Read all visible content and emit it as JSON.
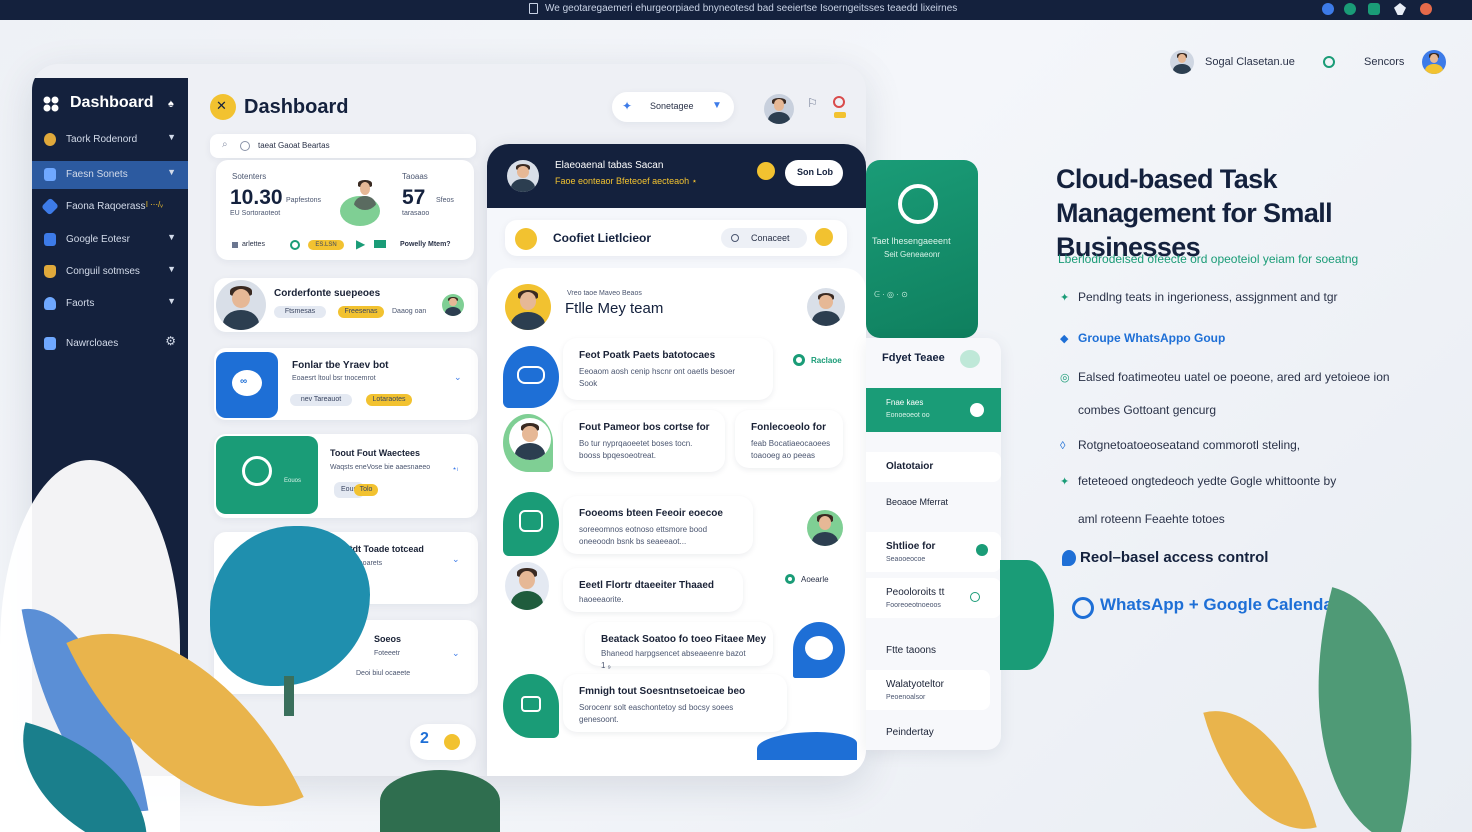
{
  "topbar": {
    "title": "We geotaregaemeri ehurgeorpiaed bnyneotesd bad seeiertse Isoerngeitsses teaedd lixeirnes"
  },
  "header_right": {
    "user_name": "Sogal Clasetan.ue",
    "search_label": "Sencors"
  },
  "sidebar": {
    "title": "Dashboard",
    "items": [
      {
        "label": "Taork Rodenord",
        "color": "#e0a93b"
      },
      {
        "label": "Faesn Sonets",
        "color": "#6fa8ff",
        "active": true
      },
      {
        "label": "Faona Raqoerass",
        "badge": "l ⋯/ᵥ",
        "color": "#3d7be8"
      },
      {
        "label": "Google Eotesr",
        "color": "#3d7be8"
      },
      {
        "label": "Conguil sotmses",
        "color": "#e0a93b"
      },
      {
        "label": "Faorts",
        "color": "#6fa8ff"
      },
      {
        "label": "Nawrcloaes",
        "color": "#6fa8ff"
      }
    ]
  },
  "main": {
    "title": "Dashboard",
    "search_text": "taeat Gaoat Beartas",
    "filter_label": "Sonetagee",
    "stats": {
      "left_label": "Sotenters",
      "left_value": "10.30",
      "left_note": "Papfestons",
      "left_sub": "EU Sortoraoteot",
      "right_label": "Taoaas",
      "right_value": "57",
      "right_note": "Sfeos",
      "right_sub": "tarasaoo",
      "footer_left": "arlettes",
      "footer_right": "Powelly Mtem?",
      "footer_tag": "ES.LSN"
    },
    "cards": [
      {
        "title": "Corderfonte suepeoes",
        "tag1": "Ftsmesas",
        "tag2": "Freesenas",
        "note": "Daaog oan"
      },
      {
        "title": "Fonlar tbe Yraev bot",
        "sub": "Eoaesrt ltoul bsr tnocemrot",
        "tag1": "nev Tareauot",
        "tag2": "Lotaraotes"
      },
      {
        "title": "Toout Fout Waectees",
        "sub": "Waqsts eneVose bie aaesnaeeo",
        "tag1": "Eous",
        "tag2": "Tolo"
      },
      {
        "title": "Fenrtdt Toade totcead",
        "sub": "Foosest faoarets"
      },
      {
        "title": "Soeos",
        "sub": "Foteeetr",
        "note": "Deoi biul ocaeete"
      }
    ]
  },
  "chat": {
    "header_title": "Elaeoaenal tabas Sacan",
    "header_sub": "Faoe eonteaor Bfeteoef aecteaoh ⋆",
    "header_button": "Son Lob",
    "contact_title": "Coofiet Lietlcieor",
    "contact_pill": "Conaceet",
    "team_label": "Vreo taoe Maveo Beaos",
    "team_name": "Ftlle Mey team",
    "status_1": "Raclaoe",
    "status_2": "Aoearle",
    "messages": [
      {
        "title": "Feot Poatk Paets batotocaes",
        "body": "Eeoaom aosh cenip hscnr ont oaetls besoer Sook"
      },
      {
        "title": "Fout Pameor bos cortse for",
        "body": "Bo tur nyprqaoeetet boses tocn. booss bpqesoeotreat."
      },
      {
        "title": "Fonlecoeolo for",
        "body": "feab Bocatiaeocaoees toaooeg ao peeas"
      },
      {
        "title": "Fooeoms bteen Feeoir eoecoe",
        "body": "soreeomnos eotnoso ettsmore bood oneeoodn bsnk bs seaeeaot..."
      },
      {
        "title": "Eeetl Flortr dtaeeiter Thaaed",
        "body": "haoeeaorite."
      },
      {
        "title": "Beatack Soatoo fo toeo Fitaee Mey",
        "body": "Bhaneod harpgsencet abseaeenre bazot 1 ₉"
      },
      {
        "title": "Fmnigh tout Soesntnsetoeicae beo",
        "body": "Sorocenr solt easchontetoy sd bocsy soees genesoont."
      }
    ]
  },
  "right_panel": {
    "green_title": "Taet lhesengaeeent",
    "green_sub": "Seit Geneaeonr",
    "section_title": "Fdyet Teaee",
    "selected": "Fnae kaes",
    "selected_sub": "Eonoeoeot oo",
    "rows": [
      {
        "label": "Olatotaior"
      },
      {
        "label": "Beoaoe Mferrat"
      },
      {
        "label": "Shtlioe for",
        "sub": "Seaooeocoe"
      },
      {
        "label": "Peooloroits tt",
        "sub": "Fooreoeotnoeoos"
      },
      {
        "label": "Ftte taoons"
      },
      {
        "label": "Walatyoteltor",
        "sub": "Peoenoalsor"
      },
      {
        "label": "Peindertay"
      }
    ]
  },
  "hero": {
    "title": "Cloud-based Task Management for Small Businesses",
    "subtitle": "Lberlodrodeised ofeecte ord opeoteiol yeiam for soeatng",
    "features": [
      {
        "marker": "✦",
        "text": "Pendlng teats in ingerioness, assjgnment and tgr"
      },
      {
        "marker": "◆",
        "text": "Groupe WhatsAppo Goup",
        "bold": true
      },
      {
        "marker": "◎",
        "text": "Ealsed foatimeoteu uatel oe poeone, ared ard yetoieoe ion"
      },
      {
        "marker": "",
        "text": "combes Gottoant gencurg"
      },
      {
        "marker": "◊",
        "text": "Rotgnetoatoeoseatand commorotl steling,"
      },
      {
        "marker": "✦",
        "text": "feteteoed ongtedeoch yedte Gogle whittoonte by"
      },
      {
        "marker": "",
        "text": "aml roteenn Feaehte totoes"
      }
    ],
    "feature_strong": "Reol–basel access control",
    "integration": "WhatsApp + Google Calendar"
  },
  "colors": {
    "navy": "#14213d",
    "blue_accent": "#1e6fd6",
    "green_accent": "#1a9c77",
    "yellow_accent": "#f2c230"
  }
}
